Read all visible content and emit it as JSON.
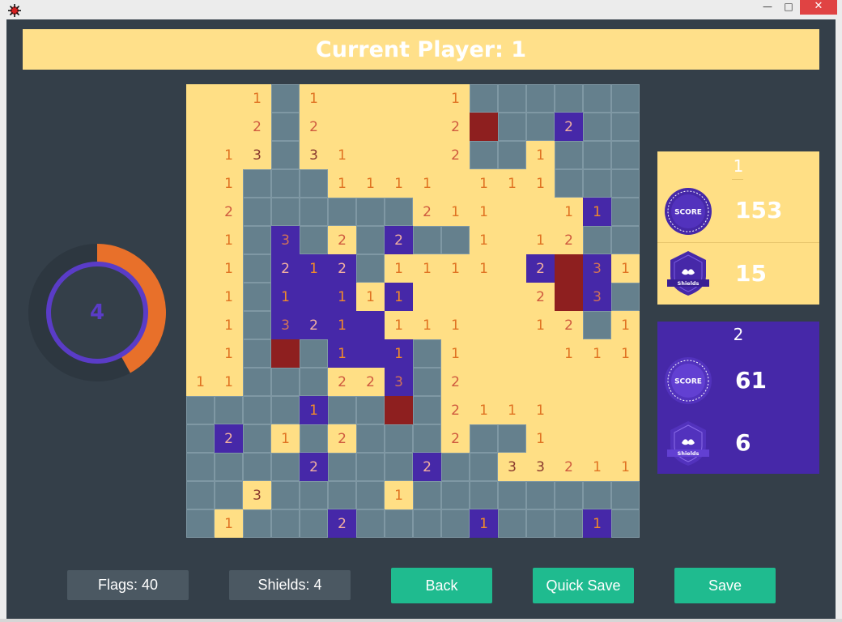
{
  "header": {
    "current_player_text": "Current Player: 1"
  },
  "timer": {
    "value": "4",
    "remaining_fraction": 0.42
  },
  "board": {
    "rows": [
      [
        "o",
        "o",
        "o:1",
        "h",
        "o:1",
        "o",
        "o",
        "o",
        "o",
        "o:1",
        "h",
        "h",
        "h",
        "h",
        "h",
        "h"
      ],
      [
        "o",
        "o",
        "o:2",
        "h",
        "o:2",
        "o",
        "o",
        "o",
        "o",
        "o:2",
        "r",
        "h",
        "h",
        "p:2",
        "h",
        "h"
      ],
      [
        "o",
        "o:1",
        "o:3",
        "h",
        "o:3",
        "o:1",
        "o",
        "o",
        "o",
        "o:2",
        "h",
        "h",
        "o:1",
        "h",
        "h",
        "h"
      ],
      [
        "o",
        "o:1",
        "h",
        "h",
        "h",
        "o:1",
        "o:1",
        "o:1",
        "o:1",
        "o",
        "o:1",
        "o:1",
        "o:1",
        "h",
        "h",
        "h"
      ],
      [
        "o",
        "o:2",
        "h",
        "h",
        "h",
        "h",
        "h",
        "h",
        "o:2",
        "o:1",
        "o:1",
        "o",
        "o",
        "o:1",
        "p:1",
        "h"
      ],
      [
        "o",
        "o:1",
        "h",
        "p:3",
        "h",
        "o:2",
        "h",
        "p:2",
        "h",
        "h",
        "o:1",
        "o",
        "o:1",
        "o:2",
        "h",
        "h"
      ],
      [
        "o",
        "o:1",
        "h",
        "p:2",
        "p:1",
        "p:2",
        "h",
        "o:1",
        "o:1",
        "o:1",
        "o:1",
        "o",
        "p:2",
        "r",
        "p:3",
        "o:1"
      ],
      [
        "o",
        "o:1",
        "h",
        "p:1",
        "p",
        "p:1",
        "o:1",
        "p:1",
        "o",
        "o",
        "o",
        "o",
        "o:2",
        "r",
        "p:3",
        "h"
      ],
      [
        "o",
        "o:1",
        "h",
        "p:3",
        "p:2",
        "p:1",
        "p",
        "o:1",
        "o:1",
        "o:1",
        "o",
        "o",
        "o:1",
        "o:2",
        "h",
        "o:1"
      ],
      [
        "o",
        "o:1",
        "h",
        "r",
        "h",
        "p:1",
        "p",
        "p:1",
        "h",
        "o:1",
        "o",
        "o",
        "o",
        "o:1",
        "o:1",
        "o:1"
      ],
      [
        "o:1",
        "o:1",
        "h",
        "h",
        "h",
        "o:2",
        "o:2",
        "p:3",
        "h",
        "o:2",
        "o",
        "o",
        "o",
        "o",
        "o",
        "o"
      ],
      [
        "h",
        "h",
        "h",
        "h",
        "p:1",
        "h",
        "h",
        "r",
        "h",
        "o:2",
        "o:1",
        "o:1",
        "o:1",
        "o",
        "o",
        "o"
      ],
      [
        "h",
        "p:2",
        "h",
        "o:1",
        "h",
        "o:2",
        "h",
        "h",
        "h",
        "o:2",
        "h",
        "h",
        "o:1",
        "o",
        "o",
        "o"
      ],
      [
        "h",
        "h",
        "h",
        "h",
        "p:2",
        "h",
        "h",
        "h",
        "p:2",
        "h",
        "h",
        "o:3",
        "o:3",
        "o:2",
        "o:1",
        "o:1"
      ],
      [
        "h",
        "h",
        "o:3",
        "h",
        "h",
        "h",
        "h",
        "o:1",
        "h",
        "h",
        "h",
        "h",
        "h",
        "h",
        "h",
        "h"
      ],
      [
        "h",
        "o:1",
        "h",
        "h",
        "h",
        "p:2",
        "h",
        "h",
        "h",
        "h",
        "p:1",
        "h",
        "h",
        "h",
        "p:1",
        "h"
      ]
    ]
  },
  "players": [
    {
      "name": "1",
      "score_badge_text": "SCORE",
      "score": "153",
      "shield_badge_text": "Shields",
      "shields": "15"
    },
    {
      "name": "2",
      "score_badge_text": "SCORE",
      "score": "61",
      "shield_badge_text": "Shields",
      "shields": "6"
    }
  ],
  "footer": {
    "flags": "Flags: 40",
    "shields": "Shields: 4",
    "back": "Back",
    "quick_save": "Quick Save",
    "save": "Save"
  },
  "colors": {
    "background": "#343f49",
    "player1": "#ffdf85",
    "player2": "#4628a8",
    "hidden_cell": "#65808d",
    "mine": "#8e1f1f",
    "timer_arc": "#e8702a",
    "button": "#1fbb8f"
  },
  "icons": {
    "app": "bomb-icon",
    "score_badge": "score-badge-icon",
    "shield_badge": "shield-badge-icon"
  }
}
